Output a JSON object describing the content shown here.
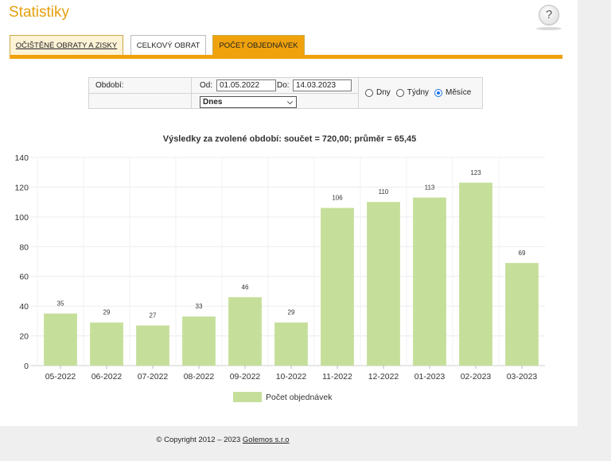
{
  "page": {
    "title": "Statistiky",
    "help_symbol": "?"
  },
  "tabs": [
    {
      "label": "OČIŠTĚNÉ OBRATY A ZISKY"
    },
    {
      "label": "CELKOVÝ OBRAT"
    },
    {
      "label": "POČET OBJEDNÁVEK"
    }
  ],
  "filter": {
    "period_label": "Období:",
    "from_label": "Od:",
    "from_value": "01.05.2022",
    "to_label": "Do:",
    "to_value": "14.03.2023",
    "preset_value": "Dnes",
    "granularity": [
      {
        "label": "Dny",
        "selected": false
      },
      {
        "label": "Týdny",
        "selected": false
      },
      {
        "label": "Měsíce",
        "selected": true
      }
    ]
  },
  "chart_data": {
    "type": "bar",
    "title": "Výsledky za zvolené období: součet = 720,00;  průměr = 65,45",
    "categories": [
      "05-2022",
      "06-2022",
      "07-2022",
      "08-2022",
      "09-2022",
      "10-2022",
      "11-2022",
      "12-2022",
      "01-2023",
      "02-2023",
      "03-2023"
    ],
    "series": [
      {
        "name": "Počet objednávek",
        "values": [
          35,
          29,
          27,
          33,
          46,
          29,
          106,
          110,
          113,
          123,
          69
        ],
        "color": "#c5df9a"
      }
    ],
    "ylim": [
      0,
      140
    ],
    "yticks": [
      0,
      20,
      40,
      60,
      80,
      100,
      120,
      140
    ],
    "grid": true,
    "legend_position": "bottom",
    "data_labels": true
  },
  "footer": {
    "text": "© Copyright 2012 – 2023",
    "link": "Golemos s.r.o"
  }
}
